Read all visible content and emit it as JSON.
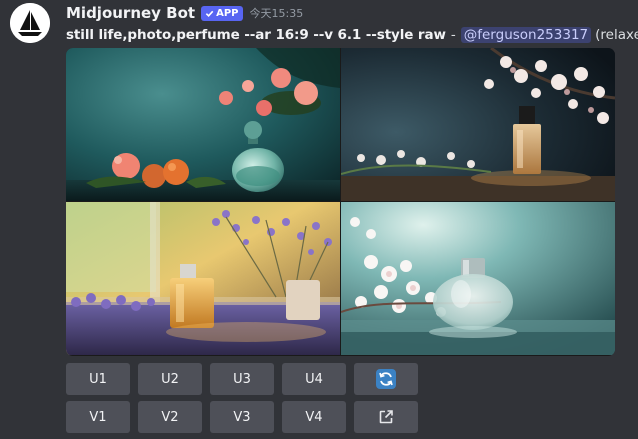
{
  "message": {
    "author": "Midjourney Bot",
    "badge": "APP",
    "timestamp": "今天15:35",
    "prompt": "still life,photo,perfume --ar 16:9 --v 6.1 --style raw",
    "separator": "-",
    "mention": "@ferguson253317",
    "mode": "(relaxed)"
  },
  "images": [
    {
      "name": "teal-perfume-with-peaches-and-flowers"
    },
    {
      "name": "amber-perfume-with-cherry-blossoms"
    },
    {
      "name": "amber-perfume-with-lavender-by-window"
    },
    {
      "name": "clear-perfume-with-white-blossoms"
    }
  ],
  "buttons": {
    "upscale": [
      "U1",
      "U2",
      "U3",
      "U4"
    ],
    "variation": [
      "V1",
      "V2",
      "V3",
      "V4"
    ],
    "reroll_icon": "refresh-icon",
    "link_icon": "external-link-icon"
  },
  "colors": {
    "background": "#313338",
    "button": "#4e5058",
    "badge": "#5865f2",
    "mention_bg": "#3c4270",
    "refresh_icon": "#3b82c4"
  }
}
